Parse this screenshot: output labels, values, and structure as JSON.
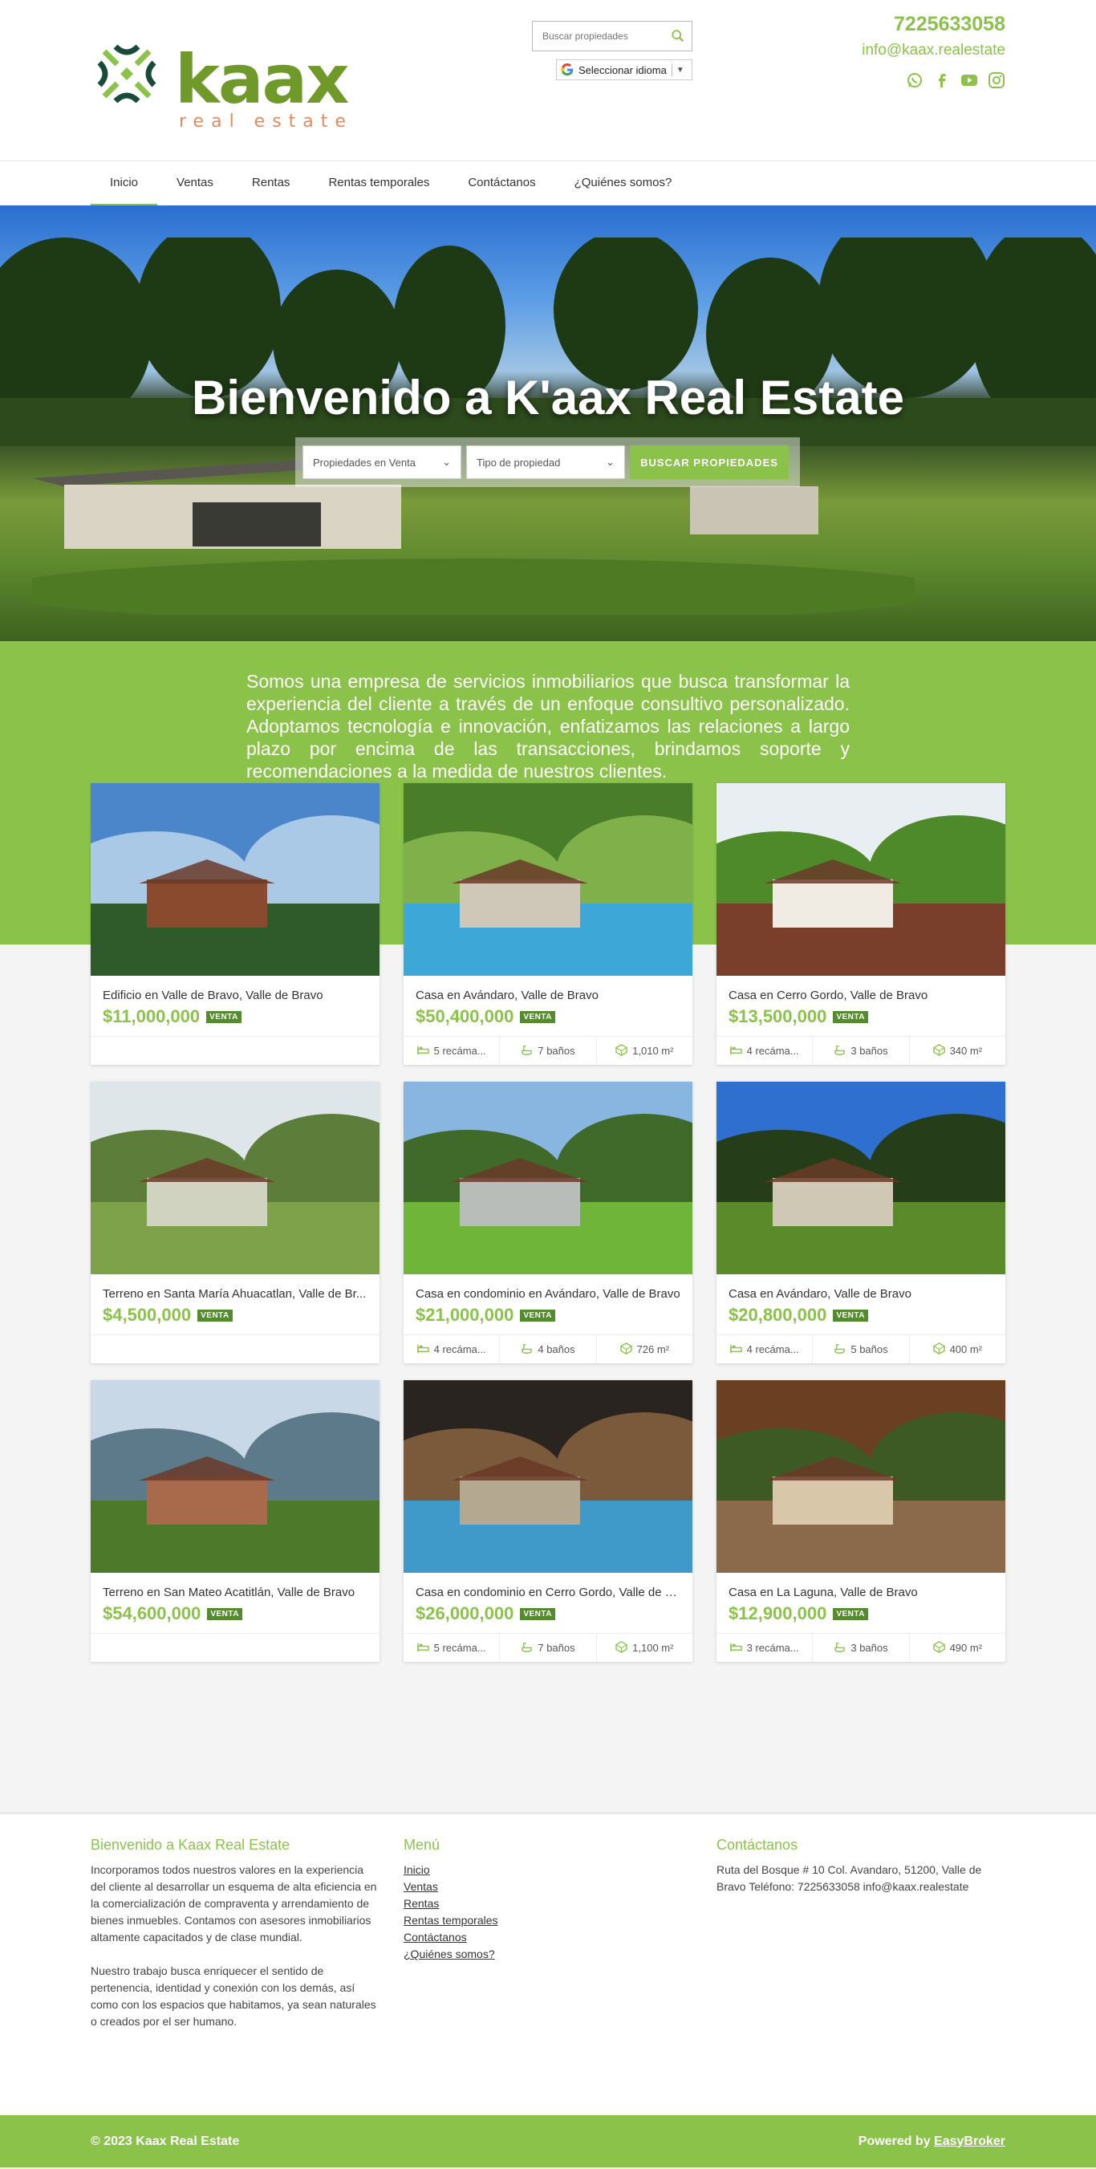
{
  "brand": {
    "name": "kaax",
    "tagline": "real estate",
    "accent": "#8bc34a",
    "dark": "#1a4a3a",
    "orange": "#e58a5c"
  },
  "header": {
    "search_placeholder": "Buscar propiedades",
    "language_label": "Seleccionar idioma",
    "phone": "7225633058",
    "email": "info@kaax.realestate",
    "socials": [
      "whatsapp-icon",
      "facebook-icon",
      "youtube-icon",
      "instagram-icon"
    ]
  },
  "nav": {
    "items": [
      "Inicio",
      "Ventas",
      "Rentas",
      "Rentas temporales",
      "Contáctanos",
      "¿Quiénes somos?"
    ],
    "active": "Inicio"
  },
  "hero": {
    "title": "Bienvenido a K'aax Real Estate",
    "operation_select": "Propiedades en Venta",
    "type_select": "Tipo de propiedad",
    "search_button": "BUSCAR PROPIEDADES"
  },
  "about": {
    "text": "Somos una empresa de servicios inmobiliarios que busca transformar la experiencia del cliente a través de un enfoque consultivo personalizado. Adoptamos tecnología e innovación, enfatizamos las relaciones a largo plazo por encima de las transacciones, brindamos soporte y recomendaciones a la medida de nuestros clientes."
  },
  "listings": [
    {
      "title": "Edificio en Valle de Bravo, Valle de Bravo",
      "price": "$11,000,000",
      "badge": "VENTA",
      "beds": "",
      "baths": "",
      "area": "",
      "scene": "lake"
    },
    {
      "title": "Casa en Avándaro, Valle de Bravo",
      "price": "$50,400,000",
      "badge": "VENTA",
      "beds": "5 recáma...",
      "baths": "7 baños",
      "area": "1,010 m²",
      "scene": "pool"
    },
    {
      "title": "Casa en Cerro Gordo, Valle de Bravo",
      "price": "$13,500,000",
      "badge": "VENTA",
      "beds": "4 recáma...",
      "baths": "3 baños",
      "area": "340 m²",
      "scene": "cottage"
    },
    {
      "title": "Terreno en Santa María Ahuacatlan, Valle de Br...",
      "price": "$4,500,000",
      "badge": "VENTA",
      "beds": "",
      "baths": "",
      "area": "",
      "scene": "hill"
    },
    {
      "title": "Casa en condominio en Avándaro, Valle de Bravo",
      "price": "$21,000,000",
      "badge": "VENTA",
      "beds": "4 recáma...",
      "baths": "4 baños",
      "area": "726 m²",
      "scene": "modern"
    },
    {
      "title": "Casa en Avándaro, Valle de Bravo",
      "price": "$20,800,000",
      "badge": "VENTA",
      "beds": "4 recáma...",
      "baths": "5 baños",
      "area": "400 m²",
      "scene": "lawn"
    },
    {
      "title": "Terreno en San Mateo Acatitlán, Valle de Bravo",
      "price": "$54,600,000",
      "badge": "VENTA",
      "beds": "",
      "baths": "",
      "area": "",
      "scene": "valley"
    },
    {
      "title": "Casa en condominio en Cerro Gordo, Valle de B...",
      "price": "$26,000,000",
      "badge": "VENTA",
      "beds": "5 recáma...",
      "baths": "7 baños",
      "area": "1,100 m²",
      "scene": "indoorpool"
    },
    {
      "title": "Casa en La Laguna, Valle de Bravo",
      "price": "$12,900,000",
      "badge": "VENTA",
      "beds": "3 recáma...",
      "baths": "3 baños",
      "area": "490 m²",
      "scene": "terrace"
    }
  ],
  "footer": {
    "col1_title": "Bienvenido a Kaax Real Estate",
    "col1_p1": "Incorporamos todos nuestros valores en la experiencia del cliente al desarrollar un esquema de alta eficiencia en la comercialización de compraventa y arrendamiento de bienes inmuebles. Contamos con asesores inmobiliarios altamente capacitados y de clase mundial.",
    "col1_p2": "Nuestro trabajo busca enriquecer el sentido de pertenencia, identidad y conexión con los demás, así como con los espacios que habitamos, ya sean naturales o creados por el ser humano.",
    "col2_title": "Menú",
    "menu": [
      "Inicio",
      "Ventas",
      "Rentas",
      "Rentas temporales",
      "Contáctanos",
      "¿Quiénes somos?"
    ],
    "col3_title": "Contáctanos",
    "contact": "Ruta del Bosque # 10 Col. Avandaro, 51200, Valle de Bravo Teléfono: 7225633058 info@kaax.realestate",
    "copyright": "© 2023 Kaax Real Estate",
    "powered_prefix": "Powered by ",
    "powered_link": "EasyBroker"
  }
}
